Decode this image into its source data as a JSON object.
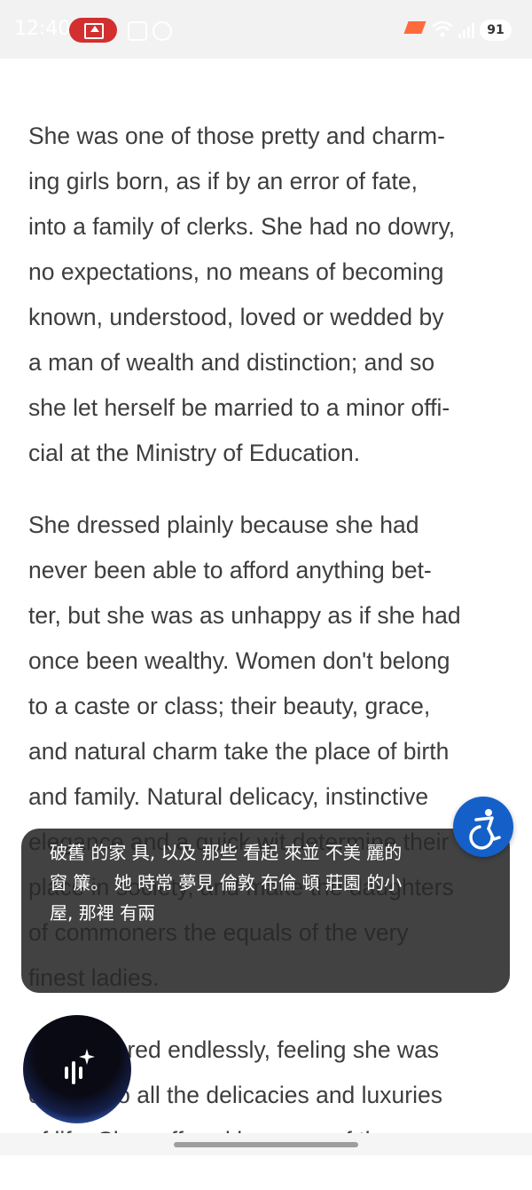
{
  "status_bar": {
    "time": "12:40",
    "battery": "91",
    "icons": [
      "screen-record-icon",
      "gallery-icon",
      "face-icon",
      "orange-app-icon",
      "wifi-icon",
      "signal-icon"
    ]
  },
  "reader": {
    "paragraphs": [
      "She was one of those pretty and charm-\ning girls born, as if by an error of fate,\ninto a family of clerks. She had no dowry,\nno expectations, no means of becoming\nknown, understood, loved or wedded by\na man of wealth and distinction; and so\nshe let herself be married to a minor offi-\ncial at the Ministry of Education.",
      "She dressed plainly because she had\nnever been able to afford anything bet-\nter, but she was as unhappy as if she had\nonce been wealthy. Women don't belong\nto a caste or class; their beauty, grace,\nand natural charm take the place of birth\nand family. Natural delicacy, instinctive\nelegance and a quick wit determine their\nplace in society, and make the daughters\nof commoners the equals of the very\nfinest ladies.",
      "She suffered endlessly, feeling she was\nentitled to all the delicacies and luxuries\nof life. She suffered because of the"
    ]
  },
  "translation_overlay": {
    "text": "破舊 的家 具, 以及 那些 看起 來並 不美 麗的\n窗 簾。 她 時常 夢見 倫敦 布倫 頓 莊園 的小\n屋, 那裡 有兩"
  },
  "colors": {
    "accent": "#1460c8",
    "record": "#d32f2f",
    "overlay": "#282828"
  }
}
